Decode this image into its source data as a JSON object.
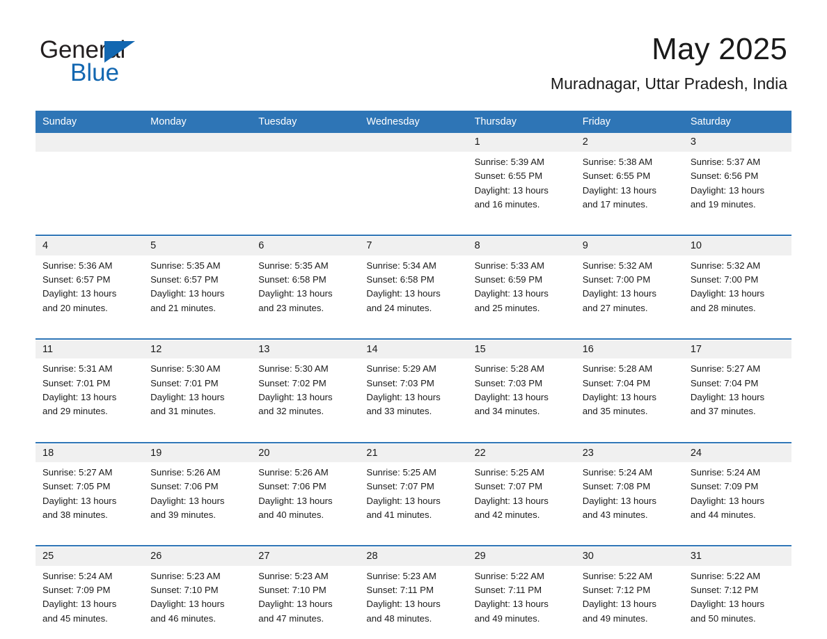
{
  "brand": {
    "name_part1": "General",
    "name_part2": "Blue",
    "triangle_color": "#1267b1"
  },
  "header": {
    "month_title": "May 2025",
    "location": "Muradnagar, Uttar Pradesh, India",
    "header_bg_color": "#2e75b6",
    "daynum_bg_color": "#f0f0f0"
  },
  "weekday_headers": [
    "Sunday",
    "Monday",
    "Tuesday",
    "Wednesday",
    "Thursday",
    "Friday",
    "Saturday"
  ],
  "weeks": [
    {
      "days": [
        {
          "num": "",
          "sunrise": "",
          "sunset": "",
          "daylight_1": "",
          "daylight_2": "",
          "empty": true
        },
        {
          "num": "",
          "sunrise": "",
          "sunset": "",
          "daylight_1": "",
          "daylight_2": "",
          "empty": true
        },
        {
          "num": "",
          "sunrise": "",
          "sunset": "",
          "daylight_1": "",
          "daylight_2": "",
          "empty": true
        },
        {
          "num": "",
          "sunrise": "",
          "sunset": "",
          "daylight_1": "",
          "daylight_2": "",
          "empty": true
        },
        {
          "num": "1",
          "sunrise": "Sunrise: 5:39 AM",
          "sunset": "Sunset: 6:55 PM",
          "daylight_1": "Daylight: 13 hours",
          "daylight_2": "and 16 minutes.",
          "empty": false
        },
        {
          "num": "2",
          "sunrise": "Sunrise: 5:38 AM",
          "sunset": "Sunset: 6:55 PM",
          "daylight_1": "Daylight: 13 hours",
          "daylight_2": "and 17 minutes.",
          "empty": false
        },
        {
          "num": "3",
          "sunrise": "Sunrise: 5:37 AM",
          "sunset": "Sunset: 6:56 PM",
          "daylight_1": "Daylight: 13 hours",
          "daylight_2": "and 19 minutes.",
          "empty": false
        }
      ]
    },
    {
      "days": [
        {
          "num": "4",
          "sunrise": "Sunrise: 5:36 AM",
          "sunset": "Sunset: 6:57 PM",
          "daylight_1": "Daylight: 13 hours",
          "daylight_2": "and 20 minutes.",
          "empty": false
        },
        {
          "num": "5",
          "sunrise": "Sunrise: 5:35 AM",
          "sunset": "Sunset: 6:57 PM",
          "daylight_1": "Daylight: 13 hours",
          "daylight_2": "and 21 minutes.",
          "empty": false
        },
        {
          "num": "6",
          "sunrise": "Sunrise: 5:35 AM",
          "sunset": "Sunset: 6:58 PM",
          "daylight_1": "Daylight: 13 hours",
          "daylight_2": "and 23 minutes.",
          "empty": false
        },
        {
          "num": "7",
          "sunrise": "Sunrise: 5:34 AM",
          "sunset": "Sunset: 6:58 PM",
          "daylight_1": "Daylight: 13 hours",
          "daylight_2": "and 24 minutes.",
          "empty": false
        },
        {
          "num": "8",
          "sunrise": "Sunrise: 5:33 AM",
          "sunset": "Sunset: 6:59 PM",
          "daylight_1": "Daylight: 13 hours",
          "daylight_2": "and 25 minutes.",
          "empty": false
        },
        {
          "num": "9",
          "sunrise": "Sunrise: 5:32 AM",
          "sunset": "Sunset: 7:00 PM",
          "daylight_1": "Daylight: 13 hours",
          "daylight_2": "and 27 minutes.",
          "empty": false
        },
        {
          "num": "10",
          "sunrise": "Sunrise: 5:32 AM",
          "sunset": "Sunset: 7:00 PM",
          "daylight_1": "Daylight: 13 hours",
          "daylight_2": "and 28 minutes.",
          "empty": false
        }
      ]
    },
    {
      "days": [
        {
          "num": "11",
          "sunrise": "Sunrise: 5:31 AM",
          "sunset": "Sunset: 7:01 PM",
          "daylight_1": "Daylight: 13 hours",
          "daylight_2": "and 29 minutes.",
          "empty": false
        },
        {
          "num": "12",
          "sunrise": "Sunrise: 5:30 AM",
          "sunset": "Sunset: 7:01 PM",
          "daylight_1": "Daylight: 13 hours",
          "daylight_2": "and 31 minutes.",
          "empty": false
        },
        {
          "num": "13",
          "sunrise": "Sunrise: 5:30 AM",
          "sunset": "Sunset: 7:02 PM",
          "daylight_1": "Daylight: 13 hours",
          "daylight_2": "and 32 minutes.",
          "empty": false
        },
        {
          "num": "14",
          "sunrise": "Sunrise: 5:29 AM",
          "sunset": "Sunset: 7:03 PM",
          "daylight_1": "Daylight: 13 hours",
          "daylight_2": "and 33 minutes.",
          "empty": false
        },
        {
          "num": "15",
          "sunrise": "Sunrise: 5:28 AM",
          "sunset": "Sunset: 7:03 PM",
          "daylight_1": "Daylight: 13 hours",
          "daylight_2": "and 34 minutes.",
          "empty": false
        },
        {
          "num": "16",
          "sunrise": "Sunrise: 5:28 AM",
          "sunset": "Sunset: 7:04 PM",
          "daylight_1": "Daylight: 13 hours",
          "daylight_2": "and 35 minutes.",
          "empty": false
        },
        {
          "num": "17",
          "sunrise": "Sunrise: 5:27 AM",
          "sunset": "Sunset: 7:04 PM",
          "daylight_1": "Daylight: 13 hours",
          "daylight_2": "and 37 minutes.",
          "empty": false
        }
      ]
    },
    {
      "days": [
        {
          "num": "18",
          "sunrise": "Sunrise: 5:27 AM",
          "sunset": "Sunset: 7:05 PM",
          "daylight_1": "Daylight: 13 hours",
          "daylight_2": "and 38 minutes.",
          "empty": false
        },
        {
          "num": "19",
          "sunrise": "Sunrise: 5:26 AM",
          "sunset": "Sunset: 7:06 PM",
          "daylight_1": "Daylight: 13 hours",
          "daylight_2": "and 39 minutes.",
          "empty": false
        },
        {
          "num": "20",
          "sunrise": "Sunrise: 5:26 AM",
          "sunset": "Sunset: 7:06 PM",
          "daylight_1": "Daylight: 13 hours",
          "daylight_2": "and 40 minutes.",
          "empty": false
        },
        {
          "num": "21",
          "sunrise": "Sunrise: 5:25 AM",
          "sunset": "Sunset: 7:07 PM",
          "daylight_1": "Daylight: 13 hours",
          "daylight_2": "and 41 minutes.",
          "empty": false
        },
        {
          "num": "22",
          "sunrise": "Sunrise: 5:25 AM",
          "sunset": "Sunset: 7:07 PM",
          "daylight_1": "Daylight: 13 hours",
          "daylight_2": "and 42 minutes.",
          "empty": false
        },
        {
          "num": "23",
          "sunrise": "Sunrise: 5:24 AM",
          "sunset": "Sunset: 7:08 PM",
          "daylight_1": "Daylight: 13 hours",
          "daylight_2": "and 43 minutes.",
          "empty": false
        },
        {
          "num": "24",
          "sunrise": "Sunrise: 5:24 AM",
          "sunset": "Sunset: 7:09 PM",
          "daylight_1": "Daylight: 13 hours",
          "daylight_2": "and 44 minutes.",
          "empty": false
        }
      ]
    },
    {
      "days": [
        {
          "num": "25",
          "sunrise": "Sunrise: 5:24 AM",
          "sunset": "Sunset: 7:09 PM",
          "daylight_1": "Daylight: 13 hours",
          "daylight_2": "and 45 minutes.",
          "empty": false
        },
        {
          "num": "26",
          "sunrise": "Sunrise: 5:23 AM",
          "sunset": "Sunset: 7:10 PM",
          "daylight_1": "Daylight: 13 hours",
          "daylight_2": "and 46 minutes.",
          "empty": false
        },
        {
          "num": "27",
          "sunrise": "Sunrise: 5:23 AM",
          "sunset": "Sunset: 7:10 PM",
          "daylight_1": "Daylight: 13 hours",
          "daylight_2": "and 47 minutes.",
          "empty": false
        },
        {
          "num": "28",
          "sunrise": "Sunrise: 5:23 AM",
          "sunset": "Sunset: 7:11 PM",
          "daylight_1": "Daylight: 13 hours",
          "daylight_2": "and 48 minutes.",
          "empty": false
        },
        {
          "num": "29",
          "sunrise": "Sunrise: 5:22 AM",
          "sunset": "Sunset: 7:11 PM",
          "daylight_1": "Daylight: 13 hours",
          "daylight_2": "and 49 minutes.",
          "empty": false
        },
        {
          "num": "30",
          "sunrise": "Sunrise: 5:22 AM",
          "sunset": "Sunset: 7:12 PM",
          "daylight_1": "Daylight: 13 hours",
          "daylight_2": "and 49 minutes.",
          "empty": false
        },
        {
          "num": "31",
          "sunrise": "Sunrise: 5:22 AM",
          "sunset": "Sunset: 7:12 PM",
          "daylight_1": "Daylight: 13 hours",
          "daylight_2": "and 50 minutes.",
          "empty": false
        }
      ]
    }
  ]
}
